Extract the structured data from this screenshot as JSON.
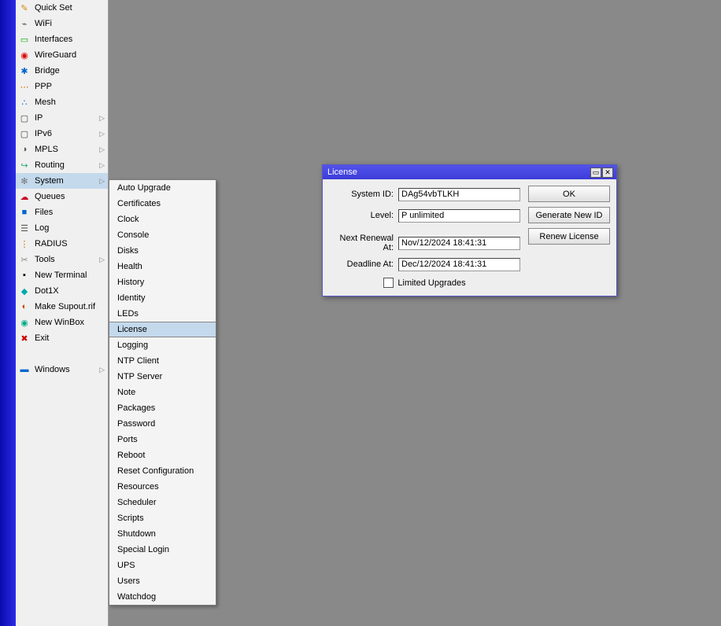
{
  "sidebar": {
    "items": [
      {
        "label": "Quick Set",
        "icon": "✎",
        "ic": "ic-paint"
      },
      {
        "label": "WiFi",
        "icon": "⌁",
        "ic": "ic-wifi"
      },
      {
        "label": "Interfaces",
        "icon": "▭",
        "ic": "ic-if"
      },
      {
        "label": "WireGuard",
        "icon": "◉",
        "ic": "ic-wg"
      },
      {
        "label": "Bridge",
        "icon": "✱",
        "ic": "ic-br"
      },
      {
        "label": "PPP",
        "icon": "⋯",
        "ic": "ic-ppp"
      },
      {
        "label": "Mesh",
        "icon": "∴",
        "ic": "ic-mesh"
      },
      {
        "label": "IP",
        "icon": "▢",
        "ic": "ic-ip",
        "arrow": true
      },
      {
        "label": "IPv6",
        "icon": "▢",
        "ic": "ic-ip",
        "arrow": true
      },
      {
        "label": "MPLS",
        "icon": "◑",
        "ic": "ic-mpls",
        "arrow": true
      },
      {
        "label": "Routing",
        "icon": "↪",
        "ic": "ic-rt",
        "arrow": true
      },
      {
        "label": "System",
        "icon": "✻",
        "ic": "ic-sys",
        "arrow": true,
        "selected": true
      },
      {
        "label": "Queues",
        "icon": "☁",
        "ic": "ic-q"
      },
      {
        "label": "Files",
        "icon": "■",
        "ic": "ic-files"
      },
      {
        "label": "Log",
        "icon": "☰",
        "ic": "ic-log"
      },
      {
        "label": "RADIUS",
        "icon": "⋮",
        "ic": "ic-rad"
      },
      {
        "label": "Tools",
        "icon": "✂",
        "ic": "ic-tools",
        "arrow": true
      },
      {
        "label": "New Terminal",
        "icon": "▪",
        "ic": "ic-term"
      },
      {
        "label": "Dot1X",
        "icon": "◆",
        "ic": "ic-dot"
      },
      {
        "label": "Make Supout.rif",
        "icon": "◐",
        "ic": "ic-sup"
      },
      {
        "label": "New WinBox",
        "icon": "◉",
        "ic": "ic-wb"
      },
      {
        "label": "Exit",
        "icon": "✖",
        "ic": "ic-exit"
      }
    ],
    "windows_label": "Windows"
  },
  "submenu": {
    "items": [
      {
        "label": "Auto Upgrade"
      },
      {
        "label": "Certificates"
      },
      {
        "label": "Clock"
      },
      {
        "label": "Console"
      },
      {
        "label": "Disks"
      },
      {
        "label": "Health"
      },
      {
        "label": "History"
      },
      {
        "label": "Identity"
      },
      {
        "label": "LEDs"
      },
      {
        "label": "License",
        "selected": true
      },
      {
        "label": "Logging"
      },
      {
        "label": "NTP Client"
      },
      {
        "label": "NTP Server"
      },
      {
        "label": "Note"
      },
      {
        "label": "Packages"
      },
      {
        "label": "Password"
      },
      {
        "label": "Ports"
      },
      {
        "label": "Reboot"
      },
      {
        "label": "Reset Configuration"
      },
      {
        "label": "Resources"
      },
      {
        "label": "Scheduler"
      },
      {
        "label": "Scripts"
      },
      {
        "label": "Shutdown"
      },
      {
        "label": "Special Login"
      },
      {
        "label": "UPS"
      },
      {
        "label": "Users"
      },
      {
        "label": "Watchdog"
      }
    ]
  },
  "dialog": {
    "title": "License",
    "fields": {
      "system_id_label": "System ID:",
      "system_id_value": "DAg54vbTLKH",
      "level_label": "Level:",
      "level_value": "P unlimited",
      "renewal_label": "Next Renewal At:",
      "renewal_value": "Nov/12/2024 18:41:31",
      "deadline_label": "Deadline At:",
      "deadline_value": "Dec/12/2024 18:41:31",
      "checkbox_label": "Limited Upgrades"
    },
    "buttons": {
      "ok": "OK",
      "gen": "Generate New ID",
      "renew": "Renew License"
    }
  }
}
